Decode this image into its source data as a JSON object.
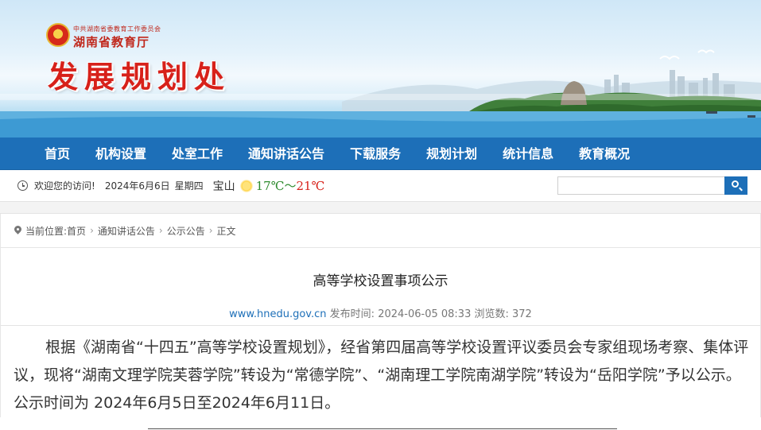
{
  "header": {
    "org_small": "中共湖南省委教育工作委员会",
    "org_name": "湖南省教育厅",
    "department": "发展规划处"
  },
  "nav": {
    "items": [
      "首页",
      "机构设置",
      "处室工作",
      "通知讲话公告",
      "下载服务",
      "规划计划",
      "统计信息",
      "教育概况"
    ]
  },
  "infobar": {
    "welcome": "欢迎您的访问!",
    "date": "2024年6月6日",
    "weekday": "星期四",
    "city": "宝山",
    "weather_icon": "sunny-icon",
    "temp_low": "17℃",
    "temp_sep": "～",
    "temp_high": "21℃",
    "search_placeholder": ""
  },
  "breadcrumb": {
    "prefix": "当前位置:",
    "items": [
      "首页",
      "通知讲话公告",
      "公示公告",
      "正文"
    ]
  },
  "article": {
    "title": "高等学校设置事项公示",
    "site": "www.hnedu.gov.cn",
    "publish_label": "发布时间:",
    "publish_time": "2024-06-05 08:33",
    "views_label": "浏览数:",
    "views": "372",
    "body": "根据《湖南省“十四五”高等学校设置规划》，经省第四届高等学校设置评议委员会专家组现场考察、集体评议，现将“湖南文理学院芙蓉学院”转设为“常德学院”、“湖南理工学院南湖学院”转设为“岳阳学院”予以公示。公示时间为 2024年6月5日至2024年6月11日。"
  },
  "colors": {
    "nav_blue": "#1d6fb8",
    "brand_red": "#d7211a",
    "temp_low_green": "#2e8b2e"
  }
}
